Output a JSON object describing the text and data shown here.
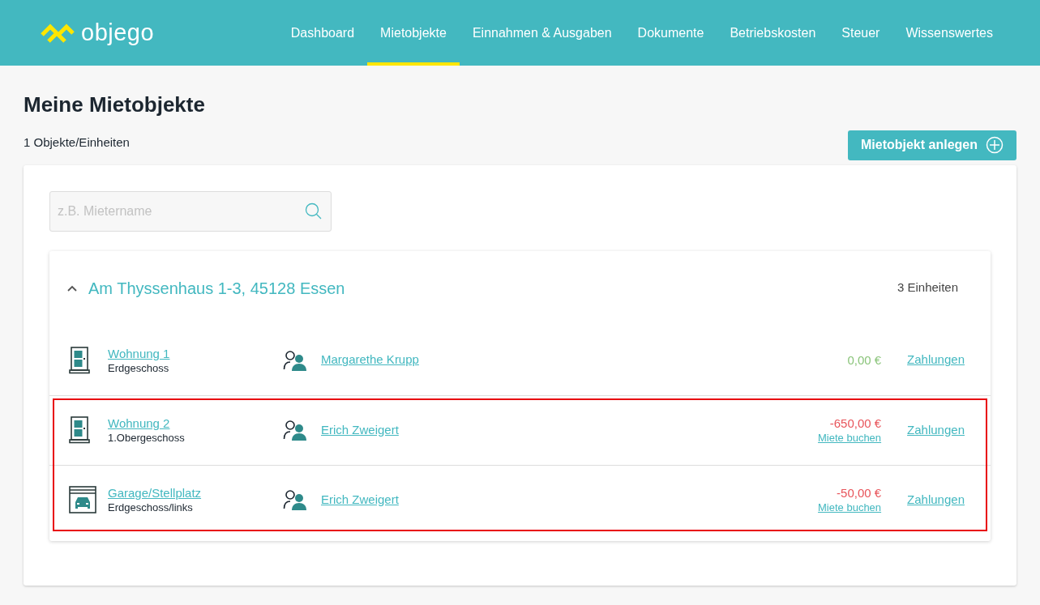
{
  "header": {
    "logo": "objego",
    "nav": [
      {
        "label": "Dashboard",
        "selected": false
      },
      {
        "label": "Mietobjekte",
        "selected": true
      },
      {
        "label": "Einnahmen & Ausgaben",
        "selected": false
      },
      {
        "label": "Dokumente",
        "selected": false
      },
      {
        "label": "Betriebskosten",
        "selected": false
      },
      {
        "label": "Steuer",
        "selected": false
      },
      {
        "label": "Wissenswertes",
        "selected": false
      }
    ]
  },
  "page": {
    "title": "Meine Mietobjekte",
    "count": "1 Objekte/Einheiten",
    "add_button": "Mietobjekt anlegen"
  },
  "search": {
    "placeholder": "z.B. Mietername"
  },
  "property": {
    "address": "Am Thyssenhaus 1-3, 45128 Essen",
    "expanded": true,
    "units_count": "3 Einheiten",
    "units": [
      {
        "kind": "apartment",
        "name": "Wohnung 1",
        "floor": "Erdgeschoss",
        "tenant": "Margarethe Krupp",
        "balance": "0,00 €",
        "color": "#8ac47a",
        "payments": "Zahlungen",
        "highlighted": false
      },
      {
        "kind": "apartment",
        "name": "Wohnung 2",
        "floor": "1.Obergeschoss",
        "tenant": "Erich Zweigert",
        "balance": "-650,00 €",
        "color": "#e8545a",
        "book_rent": "Miete buchen",
        "payments": "Zahlungen",
        "highlighted": true
      },
      {
        "kind": "garage",
        "name": "Garage/Stellplatz",
        "floor": "Erdgeschoss/links",
        "tenant": "Erich Zweigert",
        "balance": "-50,00 €",
        "color": "#e8545a",
        "book_rent": "Miete buchen",
        "payments": "Zahlungen",
        "highlighted": true
      }
    ]
  }
}
